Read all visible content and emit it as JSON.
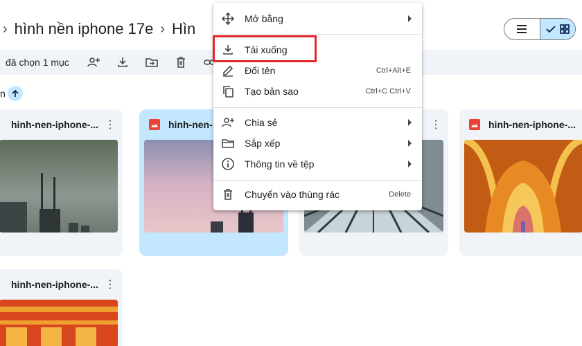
{
  "breadcrumb": {
    "folder": "hình nền iphone 17e",
    "current": "Hìn"
  },
  "selection_bar": {
    "count_label": "đã chọn 1 mục"
  },
  "sort": {
    "label": "n"
  },
  "files": [
    {
      "name": "hinh-nen-iphone-..."
    },
    {
      "name": "hinh-nen-..."
    },
    {
      "name": ""
    },
    {
      "name": "hinh-nen-iphone-..."
    },
    {
      "name": "hinh-nen-iphone-..."
    }
  ],
  "context_menu": {
    "items": [
      {
        "label": "Mở bằng",
        "icon": "open-with-icon",
        "submenu": true
      },
      {
        "label": "Tải xuống",
        "icon": "download-icon",
        "highlighted": true
      },
      {
        "label": "Đổi tên",
        "icon": "rename-icon",
        "shortcut": "Ctrl+Alt+E"
      },
      {
        "label": "Tạo bản sao",
        "icon": "copy-icon",
        "shortcut": "Ctrl+C Ctrl+V"
      },
      {
        "label": "Chia sẻ",
        "icon": "share-icon",
        "submenu": true
      },
      {
        "label": "Sắp xếp",
        "icon": "organize-icon",
        "submenu": true
      },
      {
        "label": "Thông tin về tệp",
        "icon": "info-icon",
        "submenu": true
      },
      {
        "label": "Chuyển vào thùng rác",
        "icon": "trash-icon",
        "shortcut": "Delete"
      }
    ]
  },
  "colors": {
    "accent": "#0b57d0",
    "selected_card": "#c2e7ff",
    "highlight_box": "#e3262a",
    "image_icon": "#ea4335"
  }
}
